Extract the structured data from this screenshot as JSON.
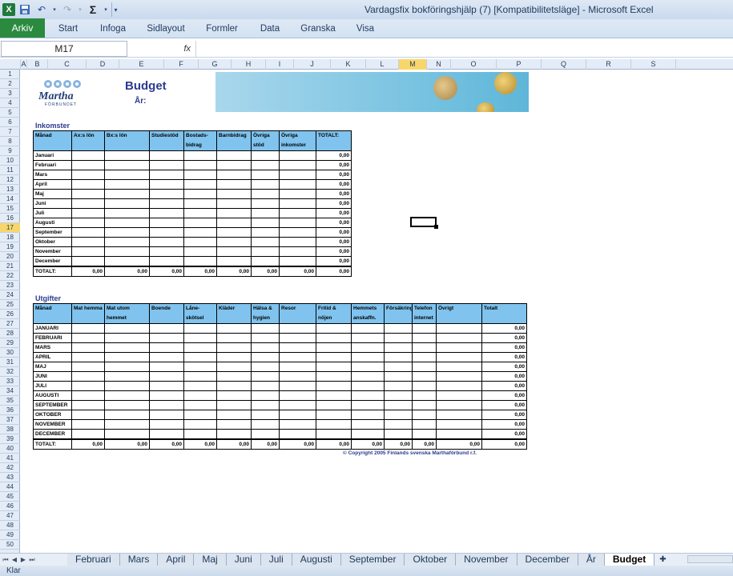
{
  "window": {
    "title": "Vardagsfix bokföringshjälp (7)  [Kompatibilitetsläge]  -  Microsoft Excel",
    "app_icon": "X"
  },
  "qat": {
    "sum_symbol": "Σ"
  },
  "ribbon": {
    "file_tab": "Arkiv",
    "tabs": [
      "Start",
      "Infoga",
      "Sidlayout",
      "Formler",
      "Data",
      "Granska",
      "Visa"
    ]
  },
  "formula_bar": {
    "name_box": "M17",
    "fx_label": "fx",
    "value": ""
  },
  "columns": [
    "A",
    "B",
    "C",
    "D",
    "E",
    "F",
    "G",
    "H",
    "I",
    "J",
    "K",
    "L",
    "M",
    "N",
    "O",
    "P",
    "Q",
    "R",
    "S"
  ],
  "rows": [
    "1",
    "2",
    "3",
    "4",
    "5",
    "6",
    "7",
    "8",
    "9",
    "10",
    "11",
    "12",
    "13",
    "14",
    "15",
    "16",
    "17",
    "18",
    "19",
    "20",
    "21",
    "22",
    "23",
    "24",
    "25",
    "26",
    "27",
    "28",
    "29",
    "30",
    "31",
    "32",
    "33",
    "34",
    "35",
    "36",
    "37",
    "38",
    "39",
    "40",
    "41",
    "42",
    "43",
    "44",
    "45",
    "46",
    "47",
    "48",
    "49",
    "50"
  ],
  "sheet": {
    "logo_name": "Martha",
    "logo_sub": "FÖRBUNDET",
    "title": "Budget",
    "year_label": "År:",
    "income": {
      "title": "Inkomster",
      "headers": [
        "Månad",
        "Ax:s lön",
        "Bx:s lön",
        "Studiestöd",
        "Bostads-bidrag",
        "Barnbidrag",
        "Övriga stöd",
        "Övriga inkomster",
        "TOTALT:"
      ],
      "months": [
        "Januari",
        "Februari",
        "Mars",
        "April",
        "Maj",
        "Juni",
        "Juli",
        "Augusti",
        "September",
        "Oktober",
        "November",
        "December"
      ],
      "row_total": "0,00",
      "total_label": "TOTALT:",
      "totals": [
        "0,00",
        "0,00",
        "0,00",
        "0,00",
        "0,00",
        "0,00",
        "0,00",
        "0,00"
      ]
    },
    "expenses": {
      "title": "Utgifter",
      "headers": [
        "Månad",
        "Mat hemma",
        "Mat utom hemmet",
        "Boende",
        "Låne-skötsel",
        "Kläder",
        "Hälsa & hygien",
        "Resor",
        "Fritid & nöjen",
        "Hemmets anskaffn.",
        "Försäkring",
        "Telefon internet",
        "Övrigt",
        "Totalt"
      ],
      "months": [
        "JANUARI",
        "FEBRUARI",
        "MARS",
        "APRIL",
        "MAJ",
        "JUNI",
        "JULI",
        "AUGUSTI",
        "SEPTEMBER",
        "OKTOBER",
        "NOVEMBER",
        "DECEMBER"
      ],
      "row_total": "0,00",
      "total_label": "TOTALT:",
      "totals": [
        "0,00",
        "0,00",
        "0,00",
        "0,00",
        "0,00",
        "0,00",
        "0,00",
        "0,00",
        "0,00",
        "0,00",
        "0,00",
        "0,00",
        "0,00"
      ]
    },
    "copyright": "© Copyright 2005 Finlands svenska Marthaförbund r.f."
  },
  "sheet_tabs": [
    "Februari",
    "Mars",
    "April",
    "Maj",
    "Juni",
    "Juli",
    "Augusti",
    "September",
    "Oktober",
    "November",
    "December",
    "År",
    "Budget"
  ],
  "active_sheet": "Budget",
  "status": "Klar"
}
